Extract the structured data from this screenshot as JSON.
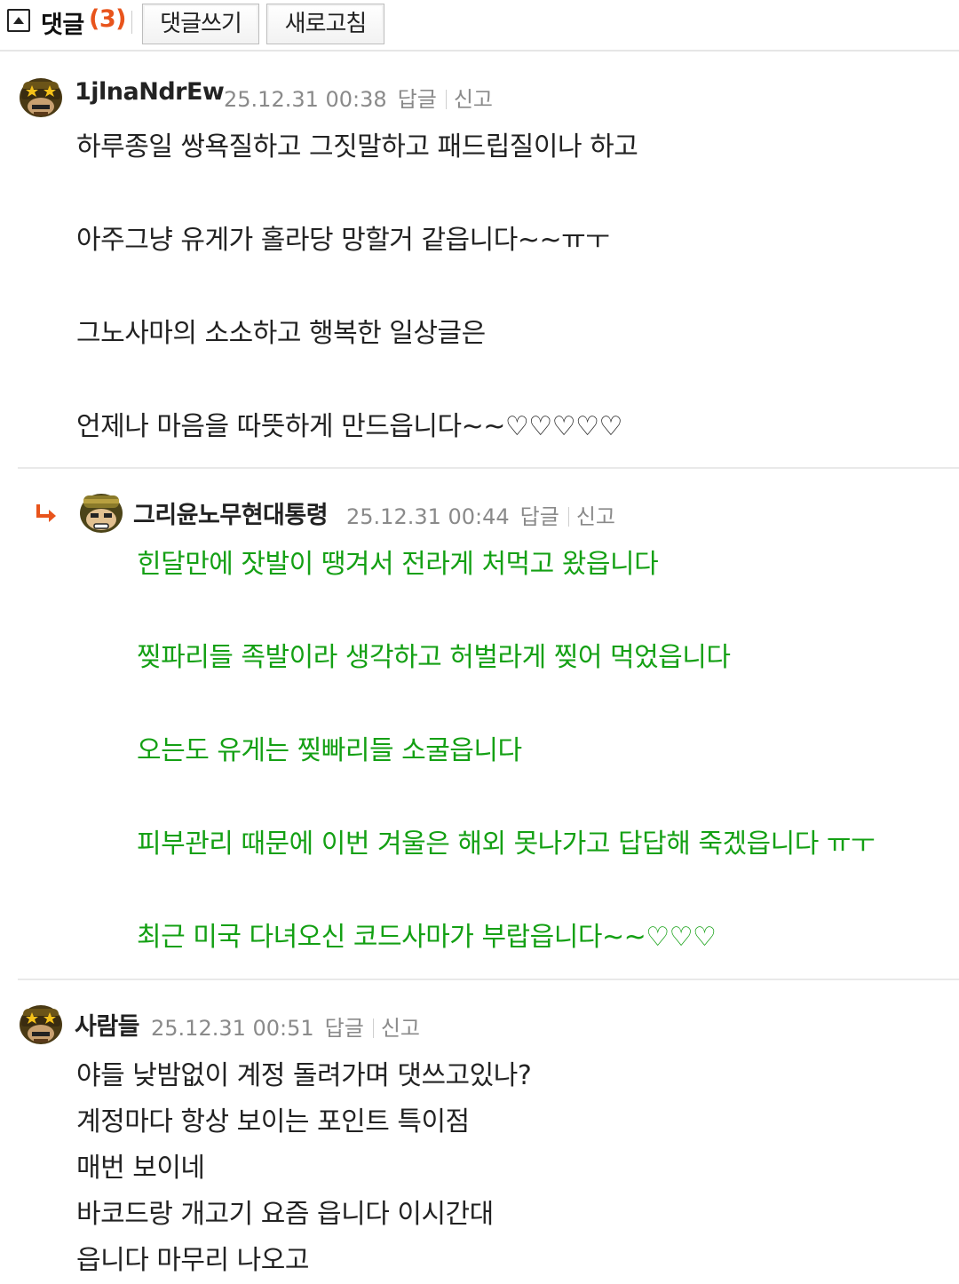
{
  "toolbar": {
    "collapse_icon": "collapse-up-icon",
    "comments_label": "댓글",
    "comments_count": "(3)",
    "write_button": "댓글쓰기",
    "refresh_button": "새로고침",
    "accent_color": "#e8541c"
  },
  "comments": [
    {
      "author": "1jlnaNdrEw",
      "datetime": "25.12.31 00:38",
      "reply_label": "답글",
      "report_label": "신고",
      "is_reply": false,
      "text_color": "#222222",
      "lines": [
        "하루종일 쌍욕질하고 그짓말하고 패드립질이나 하고",
        "아주그냥 유게가 홀라당 망할거 같읍니다~~ㅠㅜ",
        "그노사마의 소소하고 행복한 일상글은",
        "언제나 마음을 따뜻하게 만드읍니다~~♡♡♡♡♡"
      ]
    },
    {
      "author": "그리윤노무현대통령",
      "datetime": "25.12.31 00:44",
      "reply_label": "답글",
      "report_label": "신고",
      "is_reply": true,
      "text_color": "#14a014",
      "lines": [
        "힌달만에 잣발이 땡겨서 전라게 처먹고 왔읍니다",
        "찢파리들 족발이라 생각하고 허벌라게 찢어 먹었읍니다",
        "오는도 유게는 찢빠리들 소굴읍니다",
        "피부관리 때문에 이번 겨울은 해외 못나가고 답답해 죽겠읍니다 ㅠㅜ",
        "최근 미국 다녀오신 코드사마가 부랍읍니다~~♡♡♡"
      ]
    },
    {
      "author": "사람들",
      "datetime": "25.12.31 00:51",
      "reply_label": "답글",
      "report_label": "신고",
      "is_reply": false,
      "text_color": "#222222",
      "lines": [
        "야들 낮밤없이 계정 돌려가며 댓쓰고있나?",
        "계정마다 항상 보이는 포인트 특이점",
        "매번 보이네",
        "바코드랑 개고기 요즘 읍니다 이시간대",
        "읍니다 마무리 나오고"
      ]
    }
  ]
}
